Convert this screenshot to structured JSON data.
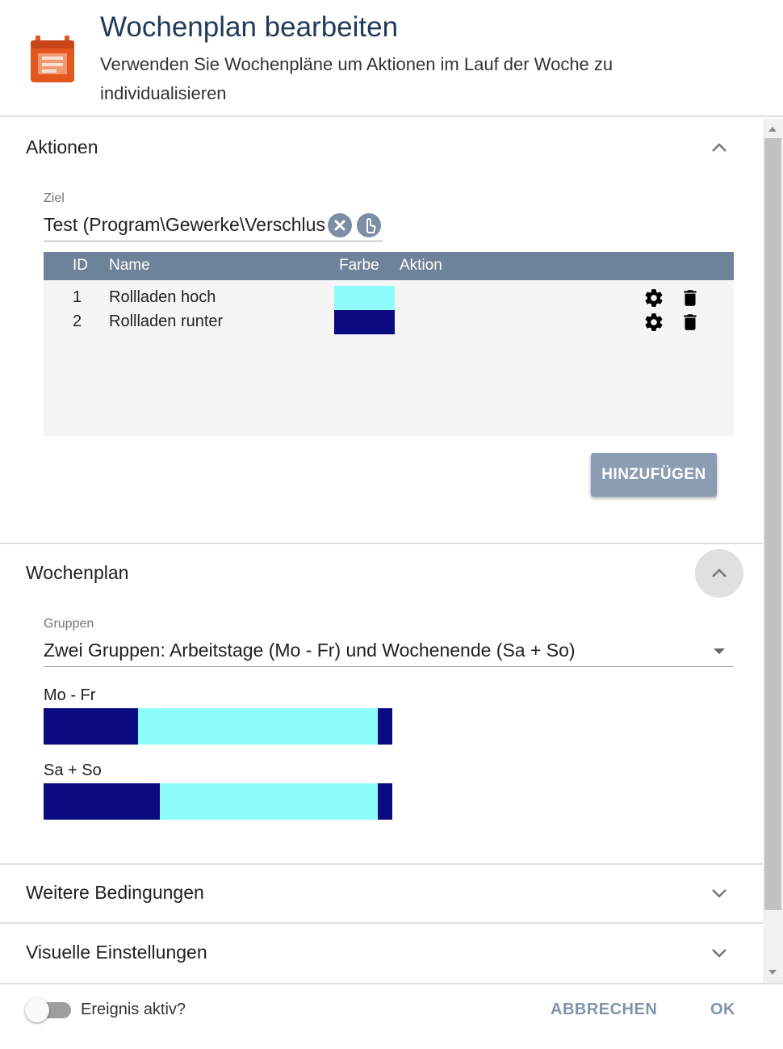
{
  "header": {
    "title": "Wochenplan bearbeiten",
    "subtitle": "Verwenden Sie Wochenpläne um Aktionen im Lauf der Woche zu individualisieren",
    "icon": "calendar-icon",
    "icon_color": "#e2571e"
  },
  "actions_section": {
    "title": "Aktionen",
    "target_label": "Ziel",
    "target_value": "Test (Program\\Gewerke\\Verschluss)",
    "columns": [
      "ID",
      "Name",
      "Farbe",
      "Aktion"
    ],
    "rows": [
      {
        "id": "1",
        "name": "Rollladen hoch",
        "color": "#8dfdfb"
      },
      {
        "id": "2",
        "name": "Rollladen runter",
        "color": "#0b0a80"
      }
    ],
    "add_button": "HINZUFÜGEN"
  },
  "schedule_section": {
    "title": "Wochenplan",
    "groups_label": "Gruppen",
    "groups_value": "Zwei Gruppen: Arbeitstage (Mo - Fr) und Wochenende (Sa + So)",
    "days": [
      {
        "label": "Mo - Fr",
        "segments": [
          {
            "color": "#0b0a80",
            "start": 0,
            "end": 0.27
          },
          {
            "color": "#8dfdfb",
            "start": 0.27,
            "end": 0.958
          },
          {
            "color": "#0b0a80",
            "start": 0.958,
            "end": 1
          }
        ]
      },
      {
        "label": "Sa + So",
        "segments": [
          {
            "color": "#0b0a80",
            "start": 0,
            "end": 0.333
          },
          {
            "color": "#8dfdfb",
            "start": 0.333,
            "end": 0.958
          },
          {
            "color": "#0b0a80",
            "start": 0.958,
            "end": 1
          }
        ]
      }
    ]
  },
  "conditions_section": {
    "title": "Weitere Bedingungen"
  },
  "visual_section": {
    "title": "Visuelle Einstellungen"
  },
  "footer": {
    "active_label": "Ereignis aktiv?",
    "active": false,
    "cancel": "ABBRECHEN",
    "ok": "OK"
  }
}
